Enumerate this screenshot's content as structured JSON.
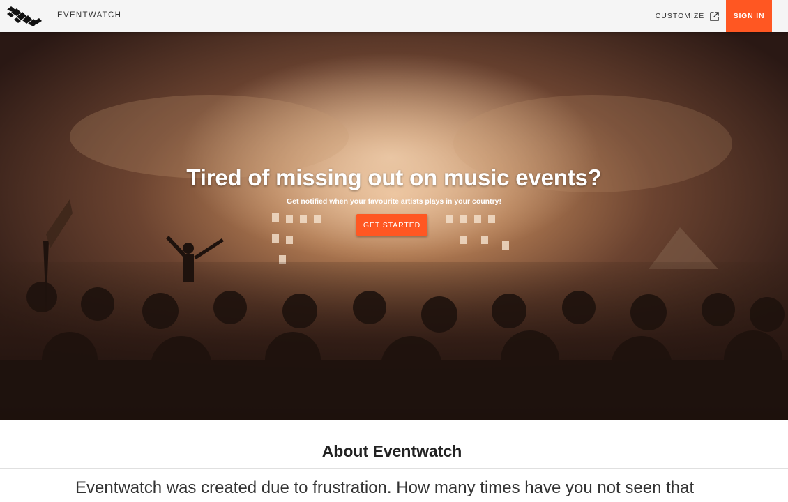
{
  "header": {
    "brand": "EVENTWATCH",
    "customize_label": "CUSTOMIZE",
    "customize_icon": "external-link-icon",
    "signin_label": "SIGN IN",
    "accent": "#ff5722"
  },
  "hero": {
    "title": "Tired of missing out on music events?",
    "subtitle": "Get notified when your favourite artists plays in your country!",
    "cta_label": "GET STARTED"
  },
  "about": {
    "title": "About Eventwatch",
    "text": "Eventwatch was created due to frustration. How many times have you not seen that"
  }
}
